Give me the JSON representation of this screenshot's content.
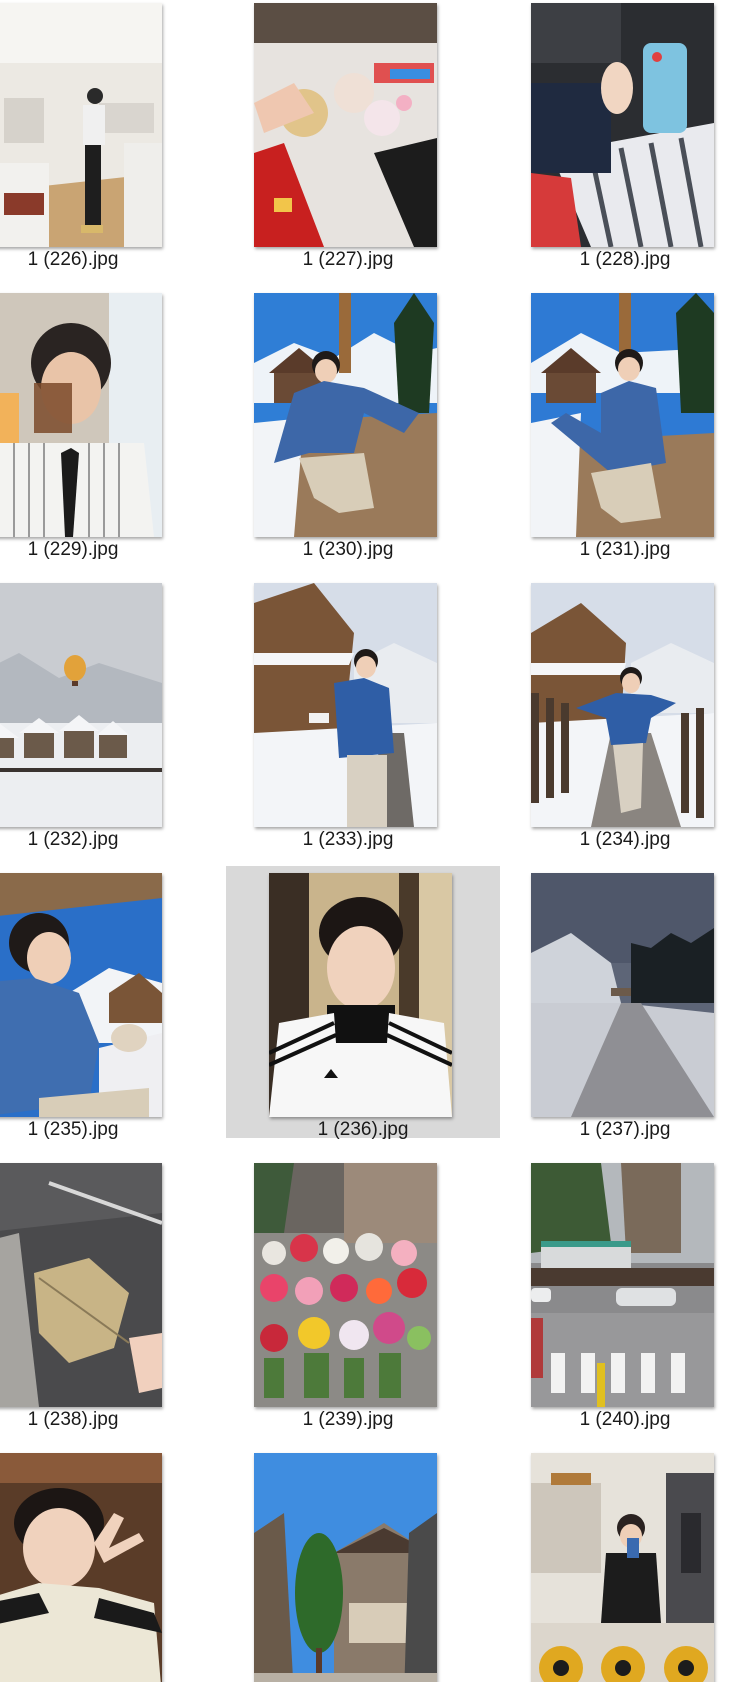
{
  "files": [
    {
      "name": "1 (226).jpg",
      "icon": "photo-gallery-interior-icon",
      "selected": false
    },
    {
      "name": "1 (227).jpg",
      "icon": "photo-drinks-toast-icon",
      "selected": false
    },
    {
      "name": "1 (228).jpg",
      "icon": "photo-car-phone-icon",
      "selected": false
    },
    {
      "name": "1 (229).jpg",
      "icon": "photo-portrait-cup-icon",
      "selected": false
    },
    {
      "name": "1 (230).jpg",
      "icon": "photo-snow-blue-jacket-icon",
      "selected": false
    },
    {
      "name": "1 (231).jpg",
      "icon": "photo-snow-blue-jacket-icon",
      "selected": false
    },
    {
      "name": "1 (232).jpg",
      "icon": "photo-balloon-mountains-icon",
      "selected": false
    },
    {
      "name": "1 (233).jpg",
      "icon": "photo-snow-path-icon",
      "selected": false
    },
    {
      "name": "1 (234).jpg",
      "icon": "photo-snow-path-icon",
      "selected": false
    },
    {
      "name": "1 (235).jpg",
      "icon": "photo-snow-portrait-icon",
      "selected": false
    },
    {
      "name": "1 (236).jpg",
      "icon": "photo-selfie-tracksuit-icon",
      "selected": true
    },
    {
      "name": "1 (237).jpg",
      "icon": "photo-snowy-road-icon",
      "selected": false
    },
    {
      "name": "1 (238).jpg",
      "icon": "photo-leaf-pavement-icon",
      "selected": false
    },
    {
      "name": "1 (239).jpg",
      "icon": "photo-flower-stall-icon",
      "selected": false
    },
    {
      "name": "1 (240).jpg",
      "icon": "photo-street-crosswalk-icon",
      "selected": false
    },
    {
      "name": "",
      "icon": "photo-peace-sign-icon",
      "selected": false
    },
    {
      "name": "",
      "icon": "photo-tree-buildings-icon",
      "selected": false
    },
    {
      "name": "",
      "icon": "photo-gym-mirror-icon",
      "selected": false
    }
  ],
  "colors": {
    "selection": "#d9d9d9",
    "text": "#1a1a1a",
    "background": "#ffffff"
  }
}
